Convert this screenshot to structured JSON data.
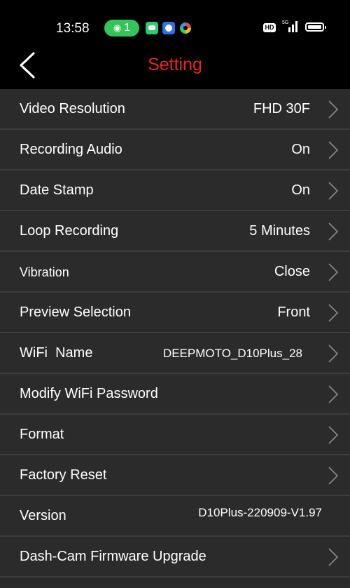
{
  "status_bar": {
    "time": "13:58",
    "wifi_badge_count": "1",
    "hd_label": "HD",
    "network_label": "5G",
    "accent_green": "#33c55a"
  },
  "header": {
    "title": "Setting",
    "title_color": "#e8251b",
    "back_icon": "chevron-left-icon"
  },
  "settings": [
    {
      "label": "Video Resolution",
      "value": "FHD 30F"
    },
    {
      "label": "Recording Audio",
      "value": "On"
    },
    {
      "label": "Date Stamp",
      "value": "On"
    },
    {
      "label": "Loop Recording",
      "value": "5 Minutes"
    },
    {
      "label": "Vibration",
      "value": "Close"
    },
    {
      "label": "Preview Selection",
      "value": "Front"
    },
    {
      "label": "WiFi  Name",
      "value": "DEEPMOTO_D10Plus_28"
    },
    {
      "label": "Modify WiFi Password",
      "value": ""
    },
    {
      "label": "Format",
      "value": ""
    },
    {
      "label": "Factory Reset",
      "value": ""
    },
    {
      "label": "Version",
      "value": "D10Plus-220909-V1.97"
    },
    {
      "label": "Dash-Cam Firmware Upgrade",
      "value": ""
    }
  ]
}
